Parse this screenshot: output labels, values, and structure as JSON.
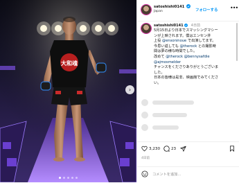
{
  "post": {
    "username": "satoshishi0141",
    "verified_icon": "verified-badge-icon",
    "location": "Japan",
    "follow_label": "フォローする",
    "more_label": "•••",
    "caption_username": "satoshishi0141",
    "caption_time": "4日前",
    "caption_line1": "5月15日より日本でスマッシングマシー",
    "caption_line2": "ンが上映されます。僕はエンセン井",
    "caption_line3_a": "上役 ",
    "caption_line3_mention": "@ensoninoue",
    "caption_line3_b": " で出演してます。",
    "caption_line4_a": "今思い返しても ",
    "caption_line4_mention": "@therock",
    "caption_line4_b": " との撮影時",
    "caption_line5": "間は夢の様な時間でした。",
    "caption_line6": "改めて ",
    "caption_line6_mention_a": "@therock",
    "caption_line6_b": " ",
    "caption_line6_mention_b": "@bennysafdie",
    "caption_line6_c": " ",
    "caption_line6_mention_c": "@ajmosmelder",
    "caption_line7": "チャンスをくださりありがとうございま",
    "caption_line8": "した。",
    "caption_line9": "日本の皆様は是非、映画館でみてくださ",
    "caption_line10": "い。"
  },
  "photo": {
    "fighter_shirt_text": "大和魂",
    "next_icon": "chevron-right-icon",
    "slide_count": 5,
    "active_slide": 1
  },
  "actions": {
    "like_icon": "heart-icon",
    "likes": "3,230",
    "comment_icon": "comment-icon",
    "comments": "23",
    "share_icon": "share-icon",
    "save_icon": "bookmark-icon",
    "date": "4日前"
  },
  "comment_box": {
    "emoji_icon": "smiley-icon",
    "placeholder": "コメントを追加..."
  },
  "colors": {
    "link_blue": "#0095f6",
    "mention": "#00376b",
    "muted": "#8e8e8e",
    "stage_purple": "#6a3fd0"
  }
}
